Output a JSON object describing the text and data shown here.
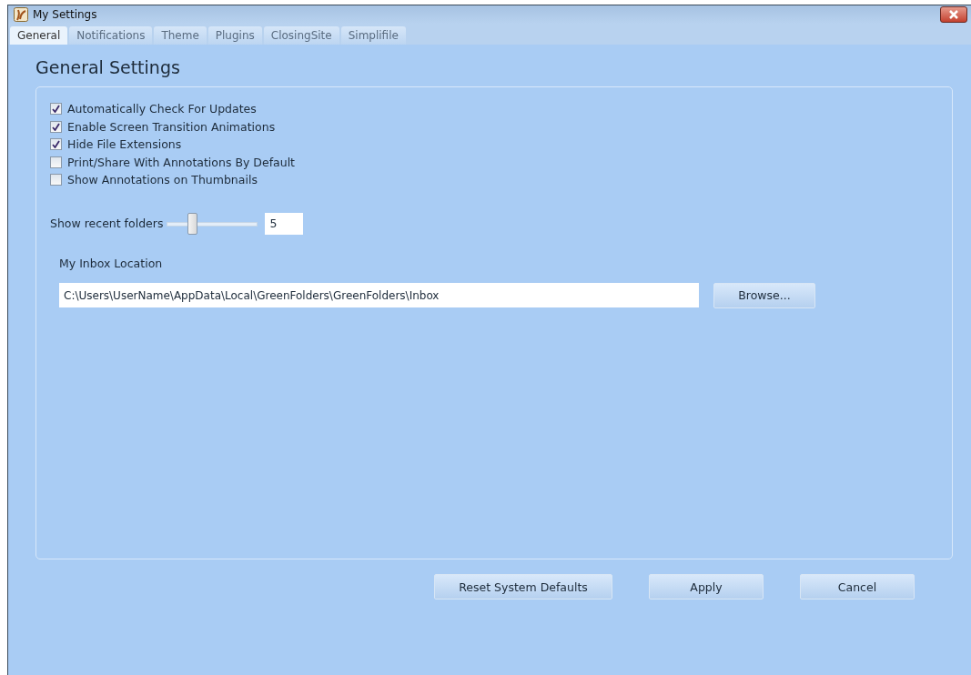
{
  "window": {
    "title": "My Settings"
  },
  "tabs": [
    {
      "label": "General",
      "selected": true
    },
    {
      "label": "Notifications",
      "selected": false
    },
    {
      "label": "Theme",
      "selected": false
    },
    {
      "label": "Plugins",
      "selected": false
    },
    {
      "label": "ClosingSite",
      "selected": false
    },
    {
      "label": "Simplifile",
      "selected": false
    }
  ],
  "heading": "General Settings",
  "options": [
    {
      "label": "Automatically Check For Updates",
      "checked": true
    },
    {
      "label": "Enable Screen Transition Animations",
      "checked": true
    },
    {
      "label": "Hide File Extensions",
      "checked": true
    },
    {
      "label": "Print/Share With Annotations By Default",
      "checked": false
    },
    {
      "label": "Show Annotations on Thumbnails",
      "checked": false
    }
  ],
  "recent_folders": {
    "label": "Show recent folders",
    "level": 0.25,
    "value": "5"
  },
  "inbox": {
    "label": "My Inbox Location",
    "value": "C:\\Users\\UserName\\AppData\\Local\\GreenFolders\\GreenFolders\\Inbox",
    "browse": "Browse..."
  },
  "buttons": [
    "Reset System Defaults",
    "Apply",
    "Cancel"
  ]
}
